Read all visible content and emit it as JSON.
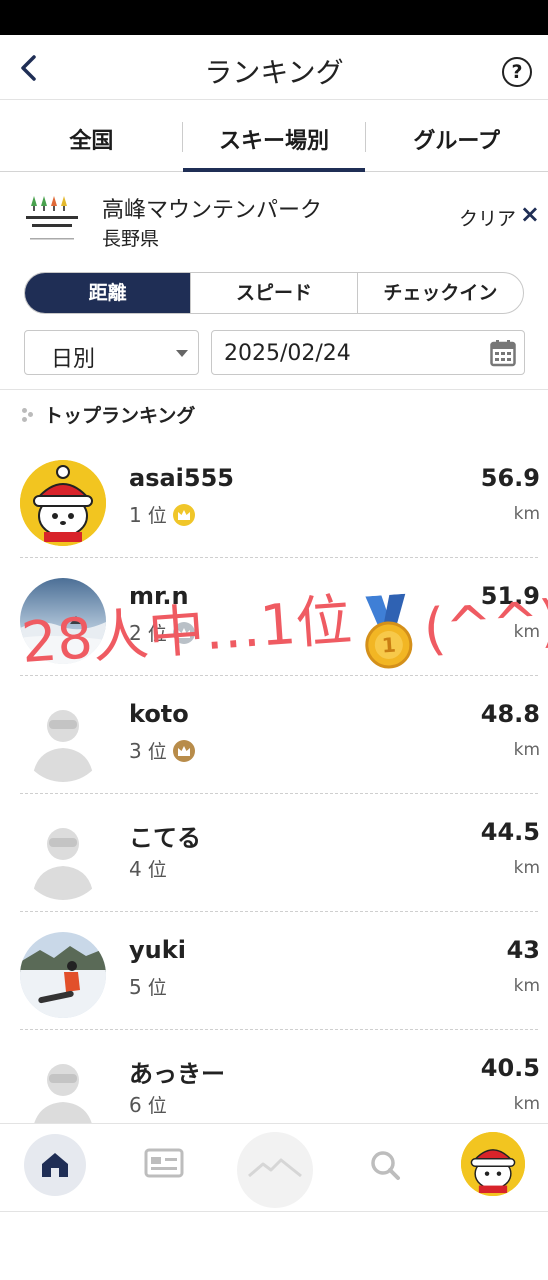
{
  "header": {
    "title": "ランキング",
    "help_label": "?"
  },
  "tabs": [
    {
      "label": "全国",
      "active": false
    },
    {
      "label": "スキー場別",
      "active": true
    },
    {
      "label": "グループ",
      "active": false
    }
  ],
  "resort": {
    "name": "高峰マウンテンパーク",
    "prefecture": "長野県",
    "clear_label": "クリア",
    "clear_icon": "×",
    "logo_text": "高峰マウンテン パーク"
  },
  "metric_tabs": [
    {
      "label": "距離",
      "active": true
    },
    {
      "label": "スピード",
      "active": false
    },
    {
      "label": "チェックイン",
      "active": false
    }
  ],
  "filter": {
    "period": "日別",
    "date": "2025/02/24"
  },
  "section_title": "トップランキング",
  "rank_suffix": "位",
  "unit": "km",
  "rankings": [
    {
      "name": "asai555",
      "rank": "1",
      "distance": "56.9",
      "crown": "gold",
      "avatar": "mascot"
    },
    {
      "name": "mr.n",
      "rank": "2",
      "distance": "51.9",
      "crown": "silver",
      "avatar": "snow-photo"
    },
    {
      "name": "koto",
      "rank": "3",
      "distance": "48.8",
      "crown": "bronze",
      "avatar": "default"
    },
    {
      "name": "こてる",
      "rank": "4",
      "distance": "44.5",
      "crown": "none",
      "avatar": "default"
    },
    {
      "name": "yuki",
      "rank": "5",
      "distance": "43",
      "crown": "none",
      "avatar": "snowboard-photo"
    },
    {
      "name": "あっきー",
      "rank": "6",
      "distance": "40.5",
      "crown": "none",
      "avatar": "default"
    }
  ],
  "annotation": {
    "text": "28人中…1位",
    "suffix": "(^^)",
    "color": "#ef5b62"
  },
  "colors": {
    "accent": "#1f2e55",
    "gold": "#f0c629",
    "silver": "#b9c0c7",
    "bronze": "#b88c4a"
  },
  "bottom_nav": [
    "home-icon",
    "card-icon",
    "mountain-icon",
    "search-icon",
    "profile-avatar"
  ]
}
